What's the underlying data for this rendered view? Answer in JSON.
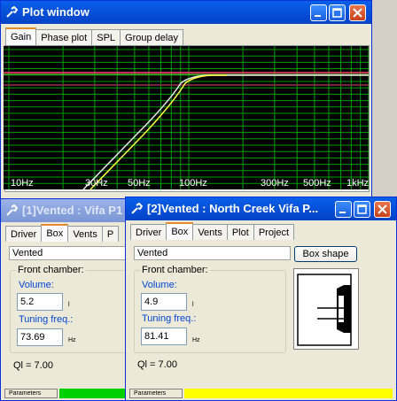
{
  "plot_window": {
    "title": "Plot window",
    "tabs": [
      "Gain",
      "Phase plot",
      "SPL",
      "Group delay"
    ],
    "x_labels": [
      "10Hz",
      "30Hz",
      "50Hz",
      "100Hz",
      "300Hz",
      "500Hz",
      "1kHz"
    ]
  },
  "win1": {
    "title": "[1]Vented : Vifa P1",
    "tabs": [
      "Driver",
      "Box",
      "Vents",
      "P"
    ],
    "box_type": "Vented",
    "front_chamber_label": "Front chamber:",
    "volume_label": "Volume:",
    "volume_value": "5.2",
    "volume_unit": "l",
    "tuning_label": "Tuning freq.:",
    "tuning_value": "73.69",
    "tuning_unit": "Hz",
    "ql": "Ql = 7.00",
    "status_label": "Parameters",
    "status_color": "#00d000"
  },
  "win2": {
    "title": "[2]Vented : North Creek Vifa P...",
    "tabs": [
      "Driver",
      "Box",
      "Vents",
      "Plot",
      "Project"
    ],
    "box_type": "Vented",
    "box_shape_button": "Box shape",
    "front_chamber_label": "Front chamber:",
    "volume_label": "Volume:",
    "volume_value": "4.9",
    "volume_unit": "l",
    "tuning_label": "Tuning freq.:",
    "tuning_value": "81.41",
    "tuning_unit": "Hz",
    "ql": "Ql = 7.00",
    "status_label": "Parameters",
    "status_color": "#ffff00"
  },
  "colors": {
    "plot_bg": "#000000",
    "grid": "#00a000",
    "ref_line": "#ff4070",
    "curve1": "#e8e8e8",
    "curve2": "#ffff40"
  }
}
